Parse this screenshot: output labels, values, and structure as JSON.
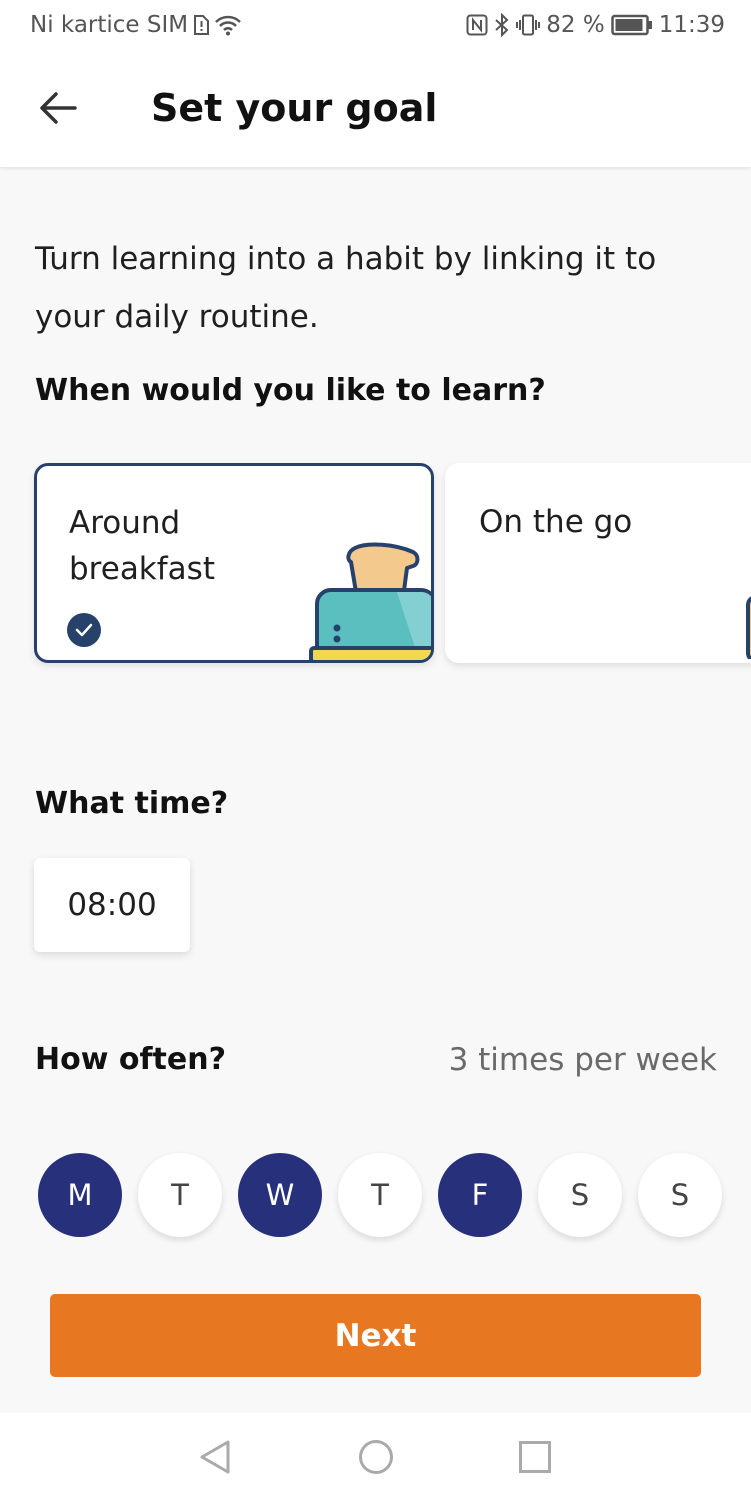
{
  "status_bar": {
    "carrier": "Ni kartice SIM",
    "battery": "82 %",
    "time": "11:39",
    "icons": [
      "sim-alert-icon",
      "wifi-icon",
      "nfc-icon",
      "bluetooth-icon",
      "vibrate-icon",
      "battery-icon"
    ]
  },
  "header": {
    "title": "Set your goal",
    "back_icon": "arrow-left-icon"
  },
  "intro_text": "Turn learning into a habit by linking it to your daily routine.",
  "when": {
    "heading": "When would you like to learn?",
    "options": [
      {
        "label": "Around breakfast",
        "selected": true,
        "illustration": "toaster"
      },
      {
        "label": "On the go",
        "selected": false,
        "illustration": "travel"
      }
    ]
  },
  "time": {
    "heading": "What time?",
    "value": "08:00"
  },
  "how_often": {
    "heading": "How often?",
    "summary": "3 times per week",
    "days": [
      {
        "label": "M",
        "selected": true
      },
      {
        "label": "T",
        "selected": false
      },
      {
        "label": "W",
        "selected": true
      },
      {
        "label": "T",
        "selected": false
      },
      {
        "label": "F",
        "selected": true
      },
      {
        "label": "S",
        "selected": false
      },
      {
        "label": "S",
        "selected": false
      }
    ]
  },
  "next_label": "Next",
  "nav_bar": {
    "icons": [
      "nav-back-icon",
      "nav-home-icon",
      "nav-recents-icon"
    ]
  },
  "colors": {
    "accent": "#e87722",
    "selected_day": "#27307a",
    "card_border": "#27426a",
    "background": "#f8f8f8"
  }
}
